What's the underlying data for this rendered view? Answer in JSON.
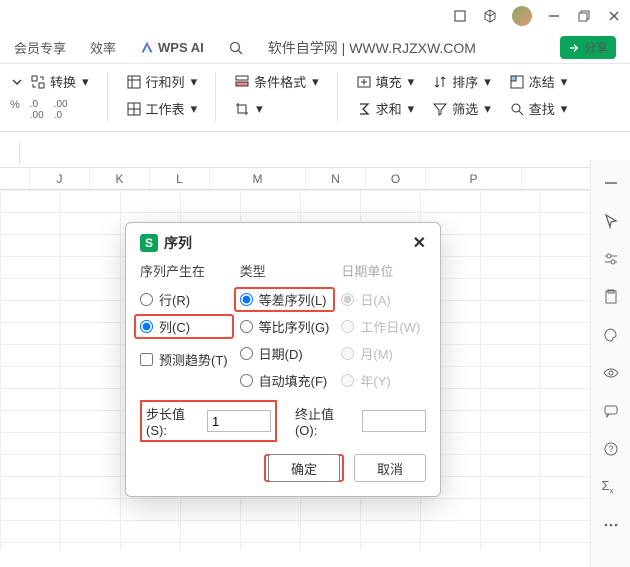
{
  "titlebar": {
    "icons": {
      "square": "square-icon",
      "cube": "cube-icon",
      "min": "minimize-icon",
      "restore": "restore-icon",
      "close": "close-icon"
    }
  },
  "topnav": {
    "tab1": "会员专享",
    "tab2": "效率",
    "ai_label": "WPS AI",
    "watermark": "软件自学网 | WWW.RJZXW.COM",
    "share": "分享"
  },
  "ribbon": {
    "convert": "转换",
    "rowcol": "行和列",
    "worksheet": "工作表",
    "condfmt": "条件格式",
    "fill": "填充",
    "sort": "排序",
    "freeze": "冻结",
    "sum": "求和",
    "filter": "筛选",
    "find": "查找"
  },
  "small": {
    "pct": "%",
    "dec": ".0",
    "thou": ".00"
  },
  "columns": [
    "J",
    "K",
    "L",
    "M",
    "N",
    "O",
    "P"
  ],
  "dialog": {
    "title": "序列",
    "close": "✕",
    "col1_hdr": "序列产生在",
    "col1_row": "行(R)",
    "col1_col": "列(C)",
    "col2_hdr": "类型",
    "col2_arith": "等差序列(L)",
    "col2_geo": "等比序列(G)",
    "col2_date": "日期(D)",
    "col2_auto": "自动填充(F)",
    "col3_hdr": "日期单位",
    "col3_day": "日(A)",
    "col3_wday": "工作日(W)",
    "col3_month": "月(M)",
    "col3_year": "年(Y)",
    "trend": "预测趋势(T)",
    "step_label": "步长值(S):",
    "step_value": "1",
    "stop_label": "终止值(O):",
    "stop_value": "",
    "ok": "确定",
    "cancel": "取消"
  }
}
